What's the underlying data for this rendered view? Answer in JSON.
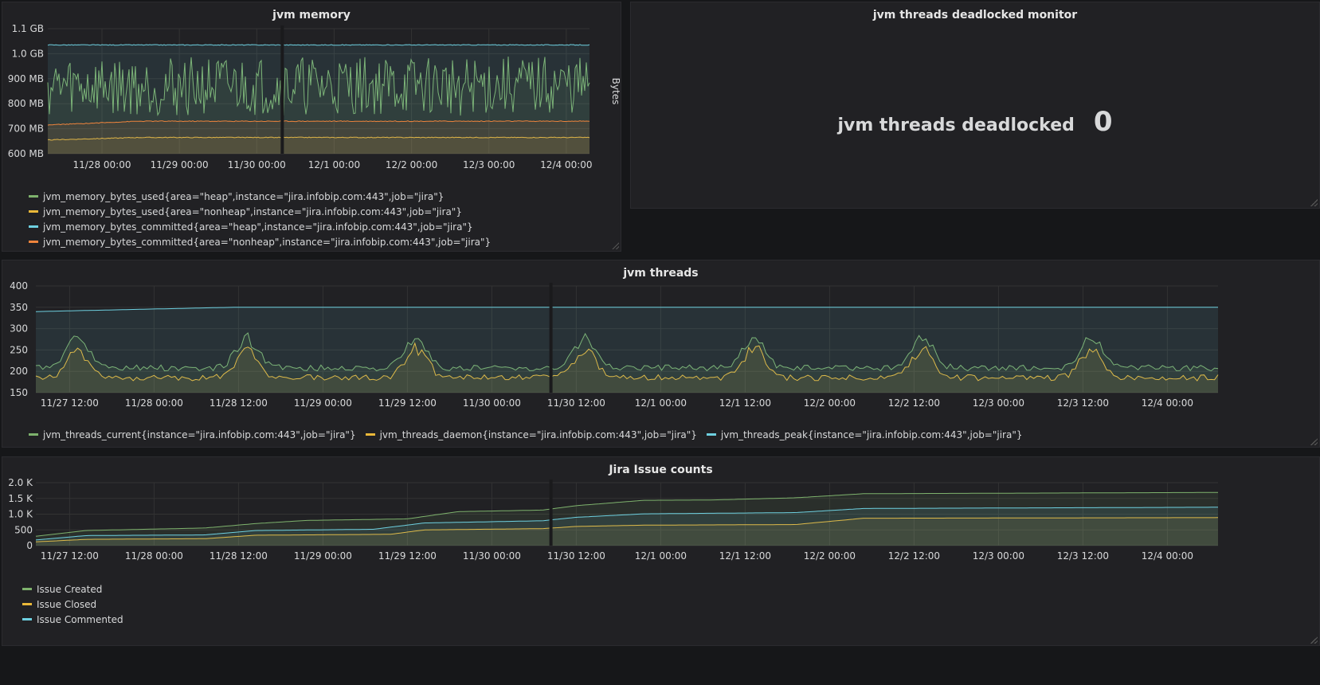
{
  "panels": {
    "memory": {
      "title": "jvm memory",
      "y_axis_label": "Bytes"
    },
    "deadlock": {
      "title": "jvm threads deadlocked monitor",
      "prefix": "jvm threads deadlocked",
      "value": "0"
    },
    "threads": {
      "title": "jvm threads"
    },
    "issues": {
      "title": "Jira Issue counts"
    }
  },
  "chart_data": [
    {
      "id": "memory",
      "type": "area",
      "title": "jvm memory",
      "ylabel": "Bytes",
      "x_ticks": [
        "11/28 00:00",
        "11/29 00:00",
        "11/30 00:00",
        "12/1 00:00",
        "12/2 00:00",
        "12/3 00:00",
        "12/4 00:00"
      ],
      "x_range_days": [
        0,
        7
      ],
      "x_tick_positions_days": [
        0.7,
        1.7,
        2.7,
        3.7,
        4.7,
        5.7,
        6.7
      ],
      "y_ticks": [
        "600 MB",
        "700 MB",
        "800 MB",
        "900 MB",
        "1.0 GB",
        "1.1 GB"
      ],
      "ylim_mb": [
        600,
        1100
      ],
      "gap_at_days": 3.03,
      "grid": true,
      "legend_placement": "bottom",
      "series": [
        {
          "name": "jvm_memory_bytes_used{area=\"heap\",instance=\"jira.infobip.com:443\",job=\"jira\"}",
          "color": "#7eb26d",
          "pattern": "noisy",
          "min": 760,
          "max": 1010,
          "mean": 870
        },
        {
          "name": "jvm_memory_bytes_used{area=\"nonheap\",instance=\"jira.infobip.com:443\",job=\"jira\"}",
          "color": "#eab839",
          "pattern": "flat",
          "start": 655,
          "end": 665
        },
        {
          "name": "jvm_memory_bytes_committed{area=\"heap\",instance=\"jira.infobip.com:443\",job=\"jira\"}",
          "color": "#6ed0e0",
          "pattern": "flat",
          "start": 1035,
          "end": 1035
        },
        {
          "name": "jvm_memory_bytes_committed{area=\"nonheap\",instance=\"jira.infobip.com:443\",job=\"jira\"}",
          "color": "#ef843c",
          "pattern": "flat",
          "start": 715,
          "end": 730
        }
      ]
    },
    {
      "id": "threads",
      "type": "area",
      "title": "jvm threads",
      "x_ticks": [
        "11/27 12:00",
        "11/28 00:00",
        "11/28 12:00",
        "11/29 00:00",
        "11/29 12:00",
        "11/30 00:00",
        "11/30 12:00",
        "12/1 00:00",
        "12/1 12:00",
        "12/2 00:00",
        "12/2 12:00",
        "12/3 00:00",
        "12/3 12:00",
        "12/4 00:00"
      ],
      "x_range_days": [
        0,
        7.0
      ],
      "x_tick_positions_days": [
        0.2,
        0.7,
        1.2,
        1.7,
        2.2,
        2.7,
        3.2,
        3.7,
        4.2,
        4.7,
        5.2,
        5.7,
        6.2,
        6.7
      ],
      "y_ticks": [
        "150",
        "200",
        "250",
        "300",
        "350",
        "400"
      ],
      "ylim": [
        150,
        400
      ],
      "gap_at_days": 3.05,
      "grid": true,
      "legend_placement": "bottom",
      "series": [
        {
          "name": "jvm_threads_current{instance=\"jira.infobip.com:443\",job=\"jira\"}",
          "color": "#7eb26d",
          "base": 208,
          "peak": 285
        },
        {
          "name": "jvm_threads_daemon{instance=\"jira.infobip.com:443\",job=\"jira\"}",
          "color": "#eab839",
          "base": 185,
          "peak": 260
        },
        {
          "name": "jvm_threads_peak{instance=\"jira.infobip.com:443\",job=\"jira\"}",
          "color": "#6ed0e0",
          "start": 340,
          "end": 350
        }
      ]
    },
    {
      "id": "issues",
      "type": "area",
      "title": "Jira Issue counts",
      "x_ticks": [
        "11/27 12:00",
        "11/28 00:00",
        "11/28 12:00",
        "11/29 00:00",
        "11/29 12:00",
        "11/30 00:00",
        "11/30 12:00",
        "12/1 00:00",
        "12/1 12:00",
        "12/2 00:00",
        "12/2 12:00",
        "12/3 00:00",
        "12/3 12:00",
        "12/4 00:00"
      ],
      "x_range_days": [
        0,
        7.0
      ],
      "x_tick_positions_days": [
        0.2,
        0.7,
        1.2,
        1.7,
        2.2,
        2.7,
        3.2,
        3.7,
        4.2,
        4.7,
        5.2,
        5.7,
        6.2,
        6.7
      ],
      "y_ticks": [
        "0",
        "500",
        "1.0 K",
        "1.5 K",
        "2.0 K"
      ],
      "ylim": [
        0,
        2000
      ],
      "gap_at_days": 3.05,
      "grid": true,
      "legend_placement": "bottom",
      "series": [
        {
          "name": "Issue Created",
          "color": "#7eb26d",
          "points": [
            [
              0,
              300
            ],
            [
              0.3,
              480
            ],
            [
              1.0,
              560
            ],
            [
              1.3,
              700
            ],
            [
              1.6,
              800
            ],
            [
              2.2,
              850
            ],
            [
              2.5,
              1080
            ],
            [
              3.0,
              1130
            ],
            [
              3.2,
              1270
            ],
            [
              3.6,
              1440
            ],
            [
              4.0,
              1450
            ],
            [
              4.5,
              1520
            ],
            [
              4.9,
              1650
            ],
            [
              7.0,
              1690
            ]
          ]
        },
        {
          "name": "Issue Closed",
          "color": "#eab839",
          "points": [
            [
              0,
              120
            ],
            [
              0.3,
              200
            ],
            [
              1.0,
              220
            ],
            [
              1.3,
              330
            ],
            [
              2.1,
              360
            ],
            [
              2.3,
              500
            ],
            [
              3.0,
              540
            ],
            [
              3.2,
              610
            ],
            [
              3.6,
              650
            ],
            [
              4.5,
              670
            ],
            [
              4.9,
              870
            ],
            [
              7.0,
              890
            ]
          ]
        },
        {
          "name": "Issue Commented",
          "color": "#6ed0e0",
          "points": [
            [
              0,
              180
            ],
            [
              0.3,
              320
            ],
            [
              1.0,
              340
            ],
            [
              1.3,
              480
            ],
            [
              2.0,
              520
            ],
            [
              2.3,
              720
            ],
            [
              3.0,
              790
            ],
            [
              3.2,
              900
            ],
            [
              3.6,
              1010
            ],
            [
              4.5,
              1050
            ],
            [
              4.9,
              1180
            ],
            [
              7.0,
              1220
            ]
          ]
        }
      ]
    }
  ]
}
